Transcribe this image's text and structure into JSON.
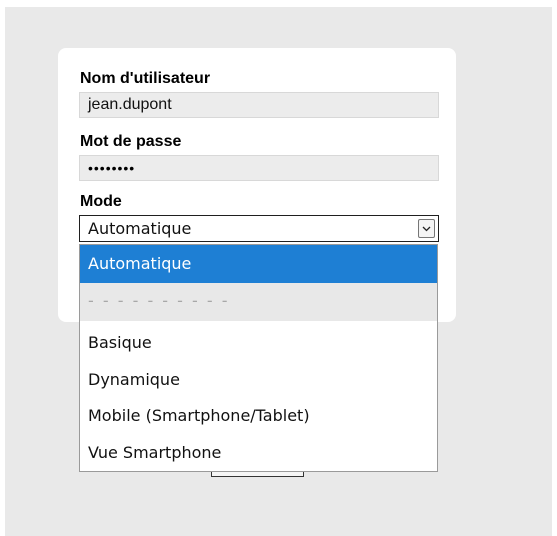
{
  "form": {
    "username_label": "Nom d'utilisateur",
    "username_value": "jean.dupont",
    "password_label": "Mot de passe",
    "password_value": "••••••••",
    "mode_label": "Mode",
    "mode_selected": "Automatique"
  },
  "dropdown": {
    "options": [
      {
        "label": "Automatique",
        "selected": true
      },
      {
        "label": "- - - - - - - - - -",
        "disabled": true
      },
      {
        "label": "Basique"
      },
      {
        "label": "Dynamique"
      },
      {
        "label": "Mobile (Smartphone/Tablet)"
      },
      {
        "label": "Vue Smartphone"
      }
    ]
  },
  "colors": {
    "selected_option_bg": "#1e7fd4",
    "separator_bg": "#e8e8e8",
    "page_bg": "#e9e9e9"
  },
  "icons": {
    "select_arrow": "chevron-down-icon"
  }
}
